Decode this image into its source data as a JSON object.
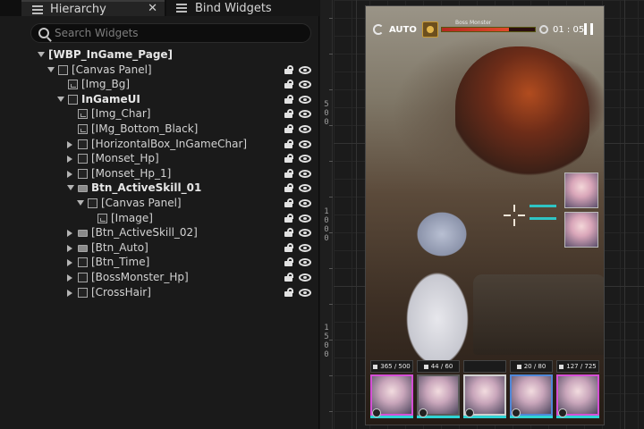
{
  "tabs": {
    "hierarchy": "Hierarchy",
    "bind_widgets": "Bind Widgets",
    "close": "✕"
  },
  "search": {
    "placeholder": "Search Widgets",
    "value": ""
  },
  "tree": [
    {
      "label": "[WBP_InGame_Page]",
      "indent": 0,
      "arrow": "down",
      "icon": "none",
      "bold": true,
      "actions": false
    },
    {
      "label": "[Canvas Panel]",
      "indent": 1,
      "arrow": "down",
      "icon": "panel",
      "bold": false,
      "actions": true
    },
    {
      "label": "[Img_Bg]",
      "indent": 2,
      "arrow": "none",
      "icon": "img",
      "bold": false,
      "actions": true
    },
    {
      "label": "InGameUI",
      "indent": 2,
      "arrow": "down",
      "icon": "panel",
      "bold": true,
      "actions": true
    },
    {
      "label": "[Img_Char]",
      "indent": 3,
      "arrow": "none",
      "icon": "img",
      "bold": false,
      "actions": true
    },
    {
      "label": "[IMg_Bottom_Black]",
      "indent": 3,
      "arrow": "none",
      "icon": "img",
      "bold": false,
      "actions": true
    },
    {
      "label": "[HorizontalBox_InGameChar]",
      "indent": 3,
      "arrow": "right",
      "icon": "panel",
      "bold": false,
      "actions": true
    },
    {
      "label": "[Monset_Hp]",
      "indent": 3,
      "arrow": "right",
      "icon": "panel",
      "bold": false,
      "actions": true
    },
    {
      "label": "[Monset_Hp_1]",
      "indent": 3,
      "arrow": "right",
      "icon": "panel",
      "bold": false,
      "actions": true
    },
    {
      "label": "Btn_ActiveSkill_01",
      "indent": 3,
      "arrow": "down",
      "icon": "btn",
      "bold": true,
      "actions": true
    },
    {
      "label": "[Canvas Panel]",
      "indent": 4,
      "arrow": "down",
      "icon": "panel",
      "bold": false,
      "actions": true
    },
    {
      "label": "[Image]",
      "indent": 5,
      "arrow": "none",
      "icon": "img",
      "bold": false,
      "actions": true
    },
    {
      "label": "[Btn_ActiveSkill_02]",
      "indent": 3,
      "arrow": "right",
      "icon": "btn",
      "bold": false,
      "actions": true
    },
    {
      "label": "[Btn_Auto]",
      "indent": 3,
      "arrow": "right",
      "icon": "btn",
      "bold": false,
      "actions": true
    },
    {
      "label": "[Btn_Time]",
      "indent": 3,
      "arrow": "right",
      "icon": "panel",
      "bold": false,
      "actions": true
    },
    {
      "label": "[BossMonster_Hp]",
      "indent": 3,
      "arrow": "right",
      "icon": "panel",
      "bold": false,
      "actions": true
    },
    {
      "label": "[CrossHair]",
      "indent": 3,
      "arrow": "right",
      "icon": "panel",
      "bold": false,
      "actions": true
    }
  ],
  "ruler": {
    "marks": [
      "500",
      "1000",
      "1500"
    ]
  },
  "game": {
    "auto_label": "AUTO",
    "boss_name": "Boss Monster",
    "boss_hp_fraction": 0.72,
    "timer": "01 : 05",
    "team": [
      {
        "hp": "365 / 500",
        "color": "#d54fd6"
      },
      {
        "hp": "44 / 60",
        "color": "#5a5a5a"
      },
      {
        "hp": "",
        "color": "#cfcfcf"
      },
      {
        "hp": "20 / 80",
        "color": "#4f87d8"
      },
      {
        "hp": "127 / 725",
        "color": "#d54fd6"
      }
    ]
  },
  "colors": {
    "accent_cyan": "#2fd4d4",
    "boss_red": "#d53a24"
  }
}
